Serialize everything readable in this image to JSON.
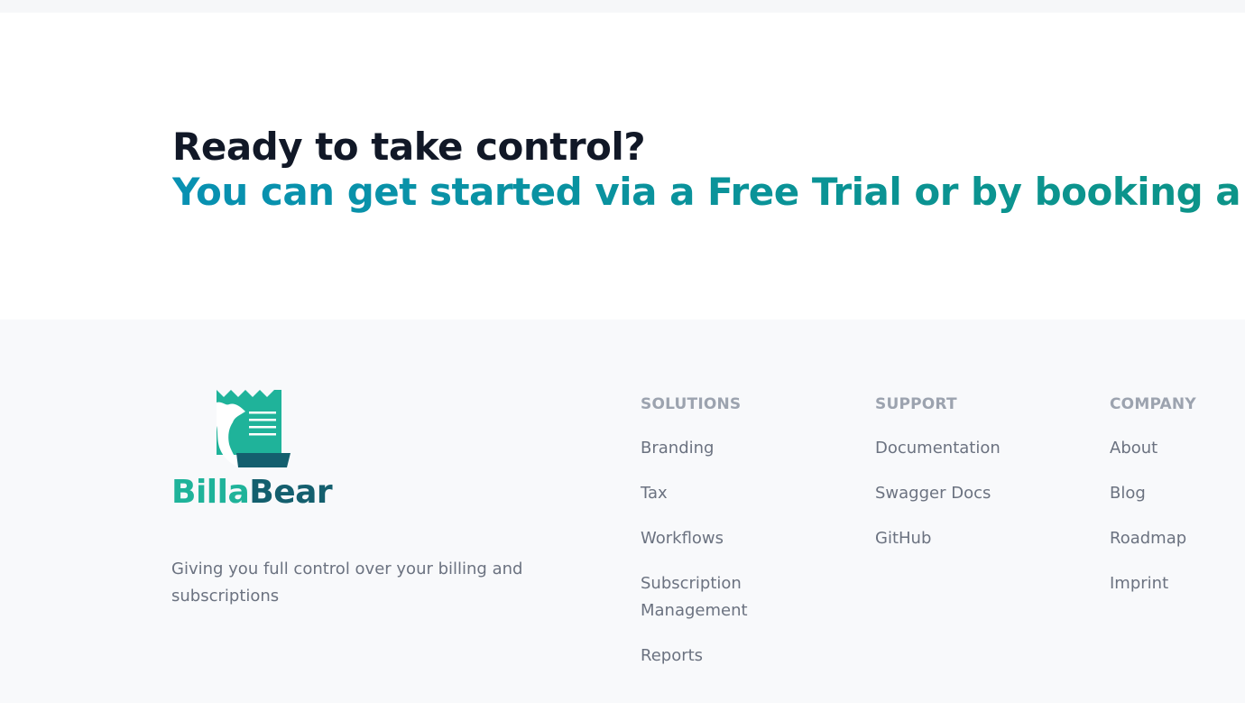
{
  "cta": {
    "title": "Ready to take control?",
    "subtitle": "You can get started via a Free Trial or by booking a demo"
  },
  "brand": {
    "name_part1": "Billa",
    "name_part2": "Bear",
    "tagline": "Giving you full control over your billing and subscriptions",
    "colors": {
      "teal": "#1fb39a",
      "dark_teal": "#145f6e"
    }
  },
  "footer": {
    "columns": [
      {
        "heading": "SOLUTIONS",
        "links": [
          "Branding",
          "Tax",
          "Workflows",
          "Subscription Management",
          "Reports"
        ]
      },
      {
        "heading": "SUPPORT",
        "links": [
          "Documentation",
          "Swagger Docs",
          "GitHub"
        ]
      },
      {
        "heading": "COMPANY",
        "links": [
          "About",
          "Blog",
          "Roadmap",
          "Imprint"
        ]
      }
    ]
  }
}
